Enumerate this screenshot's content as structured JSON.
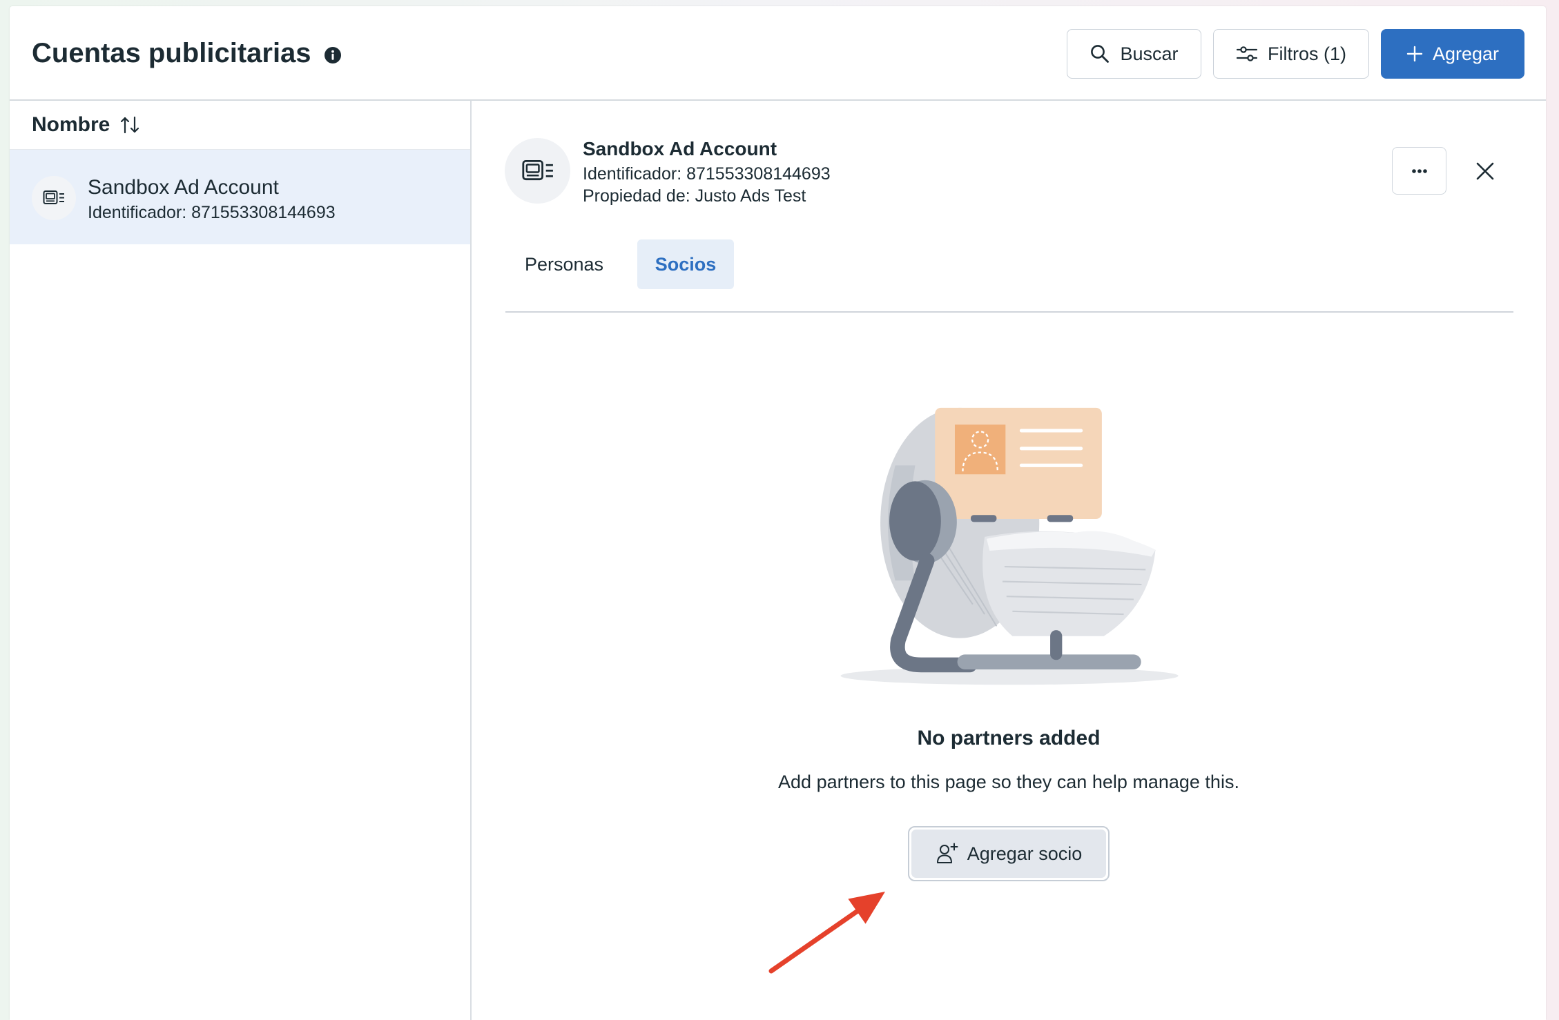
{
  "header": {
    "title": "Cuentas publicitarias",
    "info_icon": "info-icon",
    "search_button": {
      "label": "Buscar",
      "icon": "search-icon"
    },
    "filters_button": {
      "label": "Filtros (1)",
      "icon": "sliders-icon"
    },
    "add_button": {
      "label": "Agregar",
      "icon": "plus-icon"
    }
  },
  "list": {
    "column_header": "Nombre",
    "sort_icon": "sort-arrows-icon",
    "items": [
      {
        "name": "Sandbox Ad Account",
        "id_text": "Identificador: 871553308144693",
        "icon": "ad-account-icon",
        "selected": true
      }
    ]
  },
  "detail": {
    "icon": "ad-account-icon",
    "name": "Sandbox Ad Account",
    "id_text": "Identificador: 871553308144693",
    "owner_text": "Propiedad de: Justo Ads Test",
    "more_icon": "more-icon",
    "close_icon": "close-icon",
    "tabs": [
      {
        "label": "Personas",
        "active": false
      },
      {
        "label": "Socios",
        "active": true
      }
    ]
  },
  "empty_state": {
    "illustration": "rolodex-illustration",
    "title": "No partners added",
    "description": "Add partners to this page so they can help manage this.",
    "button_label": "Agregar socio",
    "button_icon": "add-person-icon"
  },
  "annotation": {
    "type": "arrow",
    "color": "#e5412b"
  },
  "colors": {
    "primary": "#2d6fc1",
    "text": "#1c2b33",
    "selected_row": "#e9f0fa",
    "active_tab": "#e6eef8",
    "border": "#d3d9df"
  }
}
